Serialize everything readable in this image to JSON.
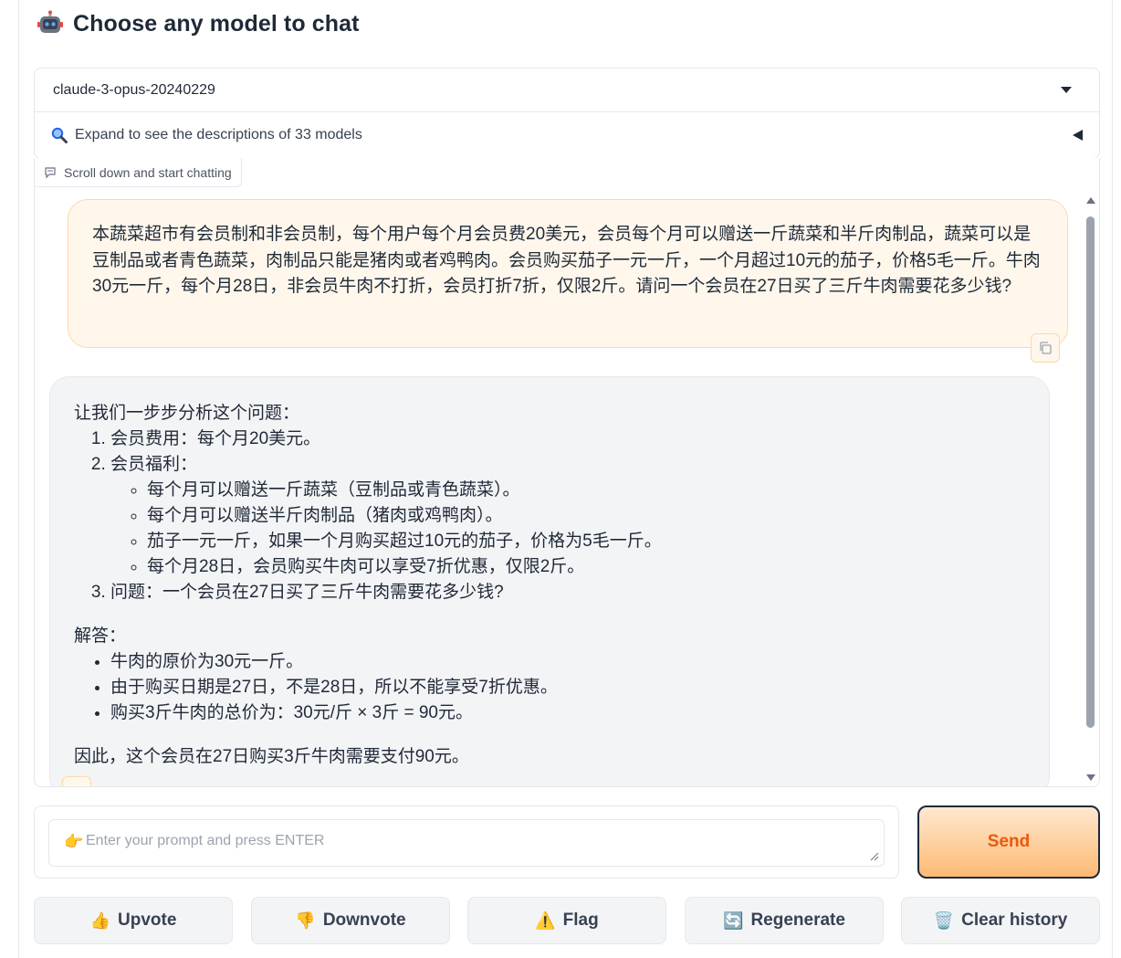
{
  "header": {
    "title": "Choose any model to chat",
    "icon": "robot-icon"
  },
  "model_select": {
    "selected": "claude-3-opus-20240229"
  },
  "accordion": {
    "label": "Expand to see the descriptions of 33 models",
    "icon": "magnifier-icon"
  },
  "chatbot": {
    "label": "Scroll down and start chatting",
    "user_message": "本蔬菜超市有会员制和非会员制，每个用户每个月会员费20美元，会员每个月可以赠送一斤蔬菜和半斤肉制品，蔬菜可以是豆制品或者青色蔬菜，肉制品只能是猪肉或者鸡鸭肉。会员购买茄子一元一斤，一个月超过10元的茄子，价格5毛一斤。牛肉30元一斤，每个月28日，非会员牛肉不打折，会员打折7折，仅限2斤。请问一个会员在27日买了三斤牛肉需要花多少钱?",
    "assistant": {
      "intro": "让我们一步步分析这个问题：",
      "step1": "会员费用：每个月20美元。",
      "step2": "会员福利：",
      "benefits": [
        "每个月可以赠送一斤蔬菜（豆制品或青色蔬菜）。",
        "每个月可以赠送半斤肉制品（猪肉或鸡鸭肉）。",
        "茄子一元一斤，如果一个月购买超过10元的茄子，价格为5毛一斤。",
        "每个月28日，会员购买牛肉可以享受7折优惠，仅限2斤。"
      ],
      "step3": "问题：一个会员在27日买了三斤牛肉需要花多少钱?",
      "answer_heading": "解答：",
      "answer_points": [
        "牛肉的原价为30元一斤。",
        "由于购买日期是27日，不是28日，所以不能享受7折优惠。",
        "购买3斤牛肉的总价为：30元/斤 × 3斤 = 90元。"
      ],
      "conclusion": "因此，这个会员在27日购买3斤牛肉需要支付90元。"
    }
  },
  "input": {
    "placeholder": "Enter your prompt and press ENTER",
    "icon": "pointing-hand-icon",
    "icon_glyph": "👉"
  },
  "send_label": "Send",
  "actions": [
    {
      "label": "Upvote",
      "icon": "thumbs-up-icon",
      "glyph": "👍"
    },
    {
      "label": "Downvote",
      "icon": "thumbs-down-icon",
      "glyph": "👎"
    },
    {
      "label": "Flag",
      "icon": "warning-icon",
      "glyph": "⚠️"
    },
    {
      "label": "Regenerate",
      "icon": "refresh-icon",
      "glyph": "🔄"
    },
    {
      "label": "Clear history",
      "icon": "trash-icon",
      "glyph": "🗑️"
    }
  ],
  "colors": {
    "accent": "#ea580c",
    "user_bubble": "#fff7ec",
    "bot_bubble": "#f3f4f6"
  }
}
